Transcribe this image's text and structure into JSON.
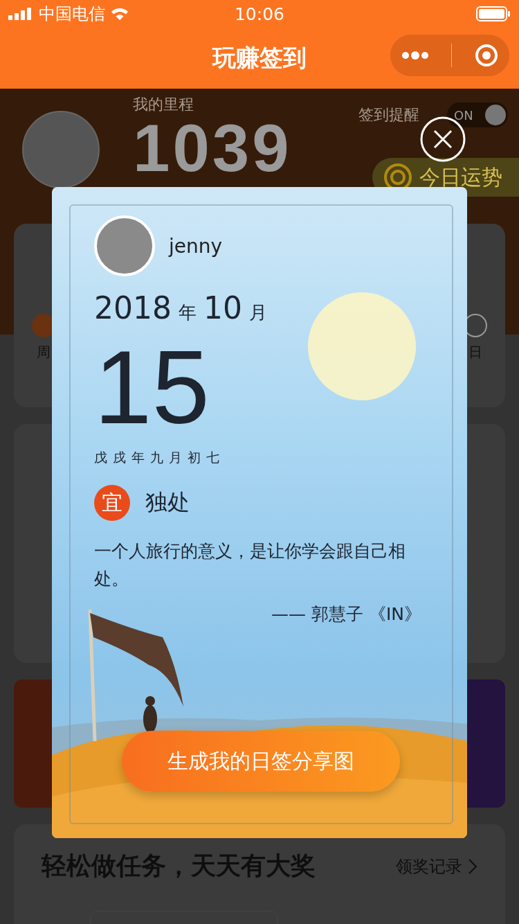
{
  "status_bar": {
    "carrier": "中国电信",
    "time": "10:06"
  },
  "nav": {
    "title": "玩赚签到"
  },
  "header": {
    "mileage_label": "我的里程",
    "mileage": "1039",
    "reminder_label": "签到提醒",
    "reminder_toggle": {
      "text": "ON",
      "on": true
    },
    "fortune_button": "今日运势"
  },
  "week": {
    "first_day": "周",
    "last_day": "日",
    "first_checked": true
  },
  "tasks": {
    "title": "轻松做任务，天天有大奖",
    "link": "领奖记录"
  },
  "modal": {
    "user": "jenny",
    "year": "2018",
    "year_unit": "年",
    "month": "10",
    "month_unit": "月",
    "day": "15",
    "lunar": "戊戌年九月初七",
    "yi_badge": "宜",
    "yi_text": "独处",
    "quote": "一个人旅行的意义，是让你学会跟自己相处。",
    "author": "—— 郭慧子 《IN》",
    "share_button": "生成我的日签分享图"
  }
}
